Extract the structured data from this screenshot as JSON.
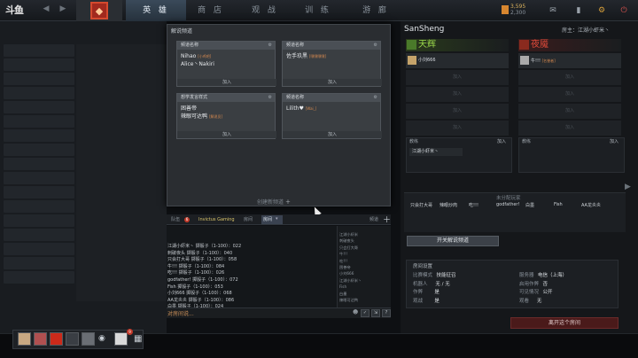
{
  "top": {
    "logo": "斗鱼",
    "nav": [
      "英 雄",
      "商 店",
      "观 战",
      "训 练",
      "游 廊"
    ],
    "gold": "3,595",
    "gold_sub": "2,300"
  },
  "dialog": {
    "title": "解说频道",
    "channels": [
      {
        "head": "频道名称",
        "users": [
          {
            "name": "Nihao",
            "tag": "[小鸡吧]"
          },
          {
            "name": "Alice丶Nakiri",
            "tag": ""
          }
        ],
        "join": "加入"
      },
      {
        "head": "频道名称",
        "users": [
          {
            "name": "佐手玖黑",
            "tag": "[嘿嘿嘿嘿]"
          }
        ],
        "join": "加入"
      },
      {
        "head": "想学发言样式",
        "users": [
          {
            "name": "困善帝",
            "tag": ""
          },
          {
            "name": "辣眼可达鸭",
            "tag": "[解说员]"
          }
        ],
        "join": "加入"
      },
      {
        "head": "频道名称",
        "users": [
          {
            "name": "Lilith♥",
            "tag": "[Wai_]"
          }
        ],
        "join": "加入"
      }
    ],
    "create": "创建新频道"
  },
  "chat": {
    "tabs": {
      "team": "队伍",
      "badge": "6",
      "guild": "Invictus Gaming",
      "lobby": "房间",
      "room": "房间",
      "channels": "频道"
    },
    "lines": [
      "江湖小虾米丶 掷骰子（1-100）：022",
      "刺破夜头 掷骰子（1-100）：040",
      "只会打大哥 掷骰子（1-100）：058",
      "牛!!! 掷骰子（1-100）：084",
      "吃!!! 掷骰子（1-100）：026",
      "godfather! 掷骰子（1-100）：072",
      "Fish 掷骰子（1-100）：053",
      "小刘666 掷骰子（1-100）：068",
      "AA龙炎炎 掷骰子（1-100）：086",
      "白墨 掷骰子（1-100）：024"
    ],
    "members": [
      "江湖小虾米",
      "刺破夜头",
      "只会打大哥",
      "牛!!!",
      "吃!!!",
      "困善帝",
      "小刘666",
      "江湖小虾米丶",
      "Fish",
      "白墨",
      "辣眼可达鸭"
    ],
    "input_placeholder": "对房间说..."
  },
  "lobby": {
    "host_name": "SanSheng",
    "host_label": "房主：江湖小虾米丶",
    "radiant": {
      "name": "天辉",
      "player": "小刘666",
      "empty": "加入",
      "color": "#9ad84a"
    },
    "dire": {
      "name": "夜魇",
      "player": "牛!!!",
      "badge": "[名誉者]",
      "empty": "加入",
      "color": "#e04a3a"
    },
    "coach_label": "教练",
    "coach_join": "加入",
    "coach_radiant": "江湖小虾米丶",
    "unassigned_title": "未分配玩家",
    "unassigned": [
      "只会打大哥",
      "辣眼炒肉",
      "吃!!!",
      "godfather!",
      "白墨",
      "Fish",
      "AA龙炎炎"
    ],
    "toggle": "开关解说频道",
    "settings_title": "房间设置",
    "settings_left": [
      [
        "比赛模式",
        "技能征召"
      ],
      [
        "机器人",
        "无 / 无"
      ],
      [
        "作弊",
        "是"
      ],
      [
        "观战",
        "是"
      ]
    ],
    "settings_right": [
      [
        "服务器",
        "电信（上海）"
      ],
      [
        "启用作弊",
        "否"
      ],
      [
        "可见情况",
        "公开"
      ],
      [
        "观看",
        "无"
      ]
    ],
    "leave": "离开这个房间"
  },
  "party": {
    "badge": "9"
  }
}
